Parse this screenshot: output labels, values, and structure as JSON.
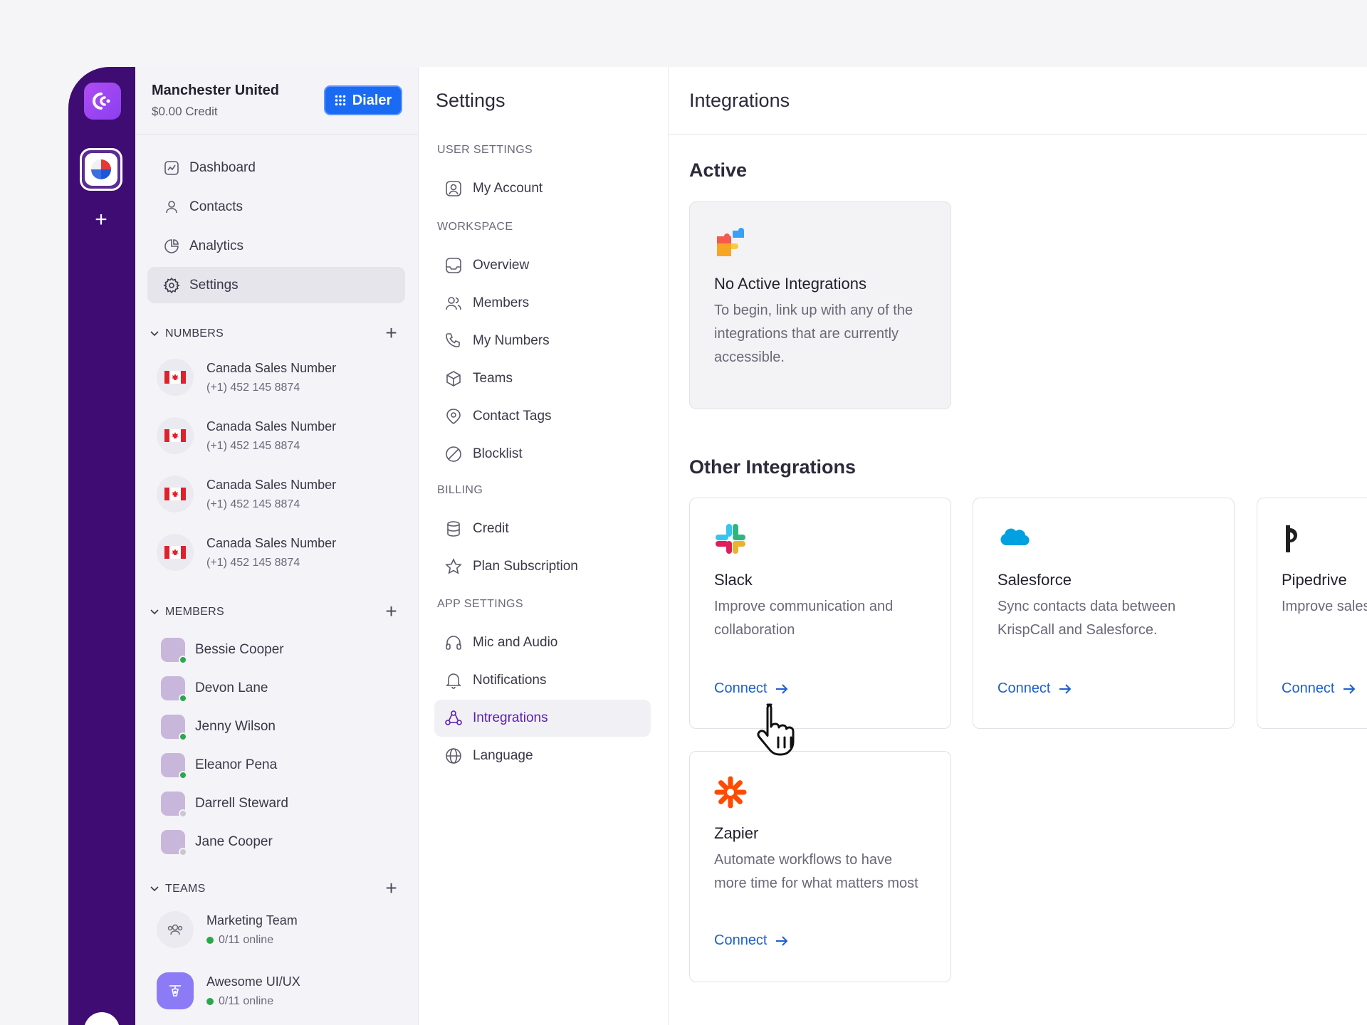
{
  "org": {
    "name": "Manchester United",
    "credit": "$0.00 Credit",
    "dialer_label": "Dialer"
  },
  "nav": [
    {
      "label": "Dashboard",
      "icon": "dashboard-icon"
    },
    {
      "label": "Contacts",
      "icon": "contacts-icon"
    },
    {
      "label": "Analytics",
      "icon": "analytics-icon"
    },
    {
      "label": "Settings",
      "icon": "gear-icon",
      "active": true
    }
  ],
  "numbers": {
    "heading": "NUMBERS",
    "items": [
      {
        "name": "Canada Sales Number",
        "phone": "(+1) 452 145 8874"
      },
      {
        "name": "Canada Sales Number",
        "phone": "(+1) 452 145 8874"
      },
      {
        "name": "Canada Sales Number",
        "phone": "(+1) 452 145 8874"
      },
      {
        "name": "Canada Sales Number",
        "phone": "(+1) 452 145 8874"
      }
    ]
  },
  "members": {
    "heading": "MEMBERS",
    "items": [
      {
        "name": "Bessie Cooper",
        "status": "online"
      },
      {
        "name": "Devon Lane",
        "status": "online"
      },
      {
        "name": "Jenny Wilson",
        "status": "online"
      },
      {
        "name": "Eleanor Pena",
        "status": "online"
      },
      {
        "name": "Darrell Steward",
        "status": "offline"
      },
      {
        "name": "Jane Cooper",
        "status": "offline"
      }
    ]
  },
  "teams": {
    "heading": "TEAMS",
    "items": [
      {
        "name": "Marketing Team",
        "online": "0/11 online"
      },
      {
        "name": "Awesome UI/UX",
        "online": "0/11 online"
      }
    ]
  },
  "settings": {
    "title": "Settings",
    "groups": {
      "user": "USER SETTINGS",
      "workspace": "WORKSPACE",
      "billing": "BILLING",
      "app": "APP SETTINGS"
    },
    "items": {
      "my_account": "My Account",
      "overview": "Overview",
      "members": "Members",
      "my_numbers": "My Numbers",
      "teams": "Teams",
      "contact_tags": "Contact Tags",
      "blocklist": "Blocklist",
      "credit": "Credit",
      "plan_subscription": "Plan Subscription",
      "mic_audio": "Mic and Audio",
      "notifications": "Notifications",
      "integrations": "Intregrations",
      "language": "Language"
    }
  },
  "integrations": {
    "title": "Integrations",
    "active_heading": "Active",
    "empty": {
      "title": "No Active Integrations",
      "desc": "To begin, link up with any of the integrations that are currently accessible."
    },
    "other_heading": "Other Integrations",
    "connect_label": "Connect",
    "cards": [
      {
        "name": "Slack",
        "desc": "Improve communication and collaboration"
      },
      {
        "name": "Salesforce",
        "desc": "Sync contacts data between KrispCall and Salesforce."
      },
      {
        "name": "Pipedrive",
        "desc": "Improve sales processes &"
      },
      {
        "name": "Zapier",
        "desc": "Automate workflows to have more time for what matters most"
      }
    ]
  },
  "colors": {
    "rail": "#3e0c73",
    "accent": "#1a6af4",
    "link": "#1a5fd6",
    "active_text": "#5a1fb0"
  }
}
